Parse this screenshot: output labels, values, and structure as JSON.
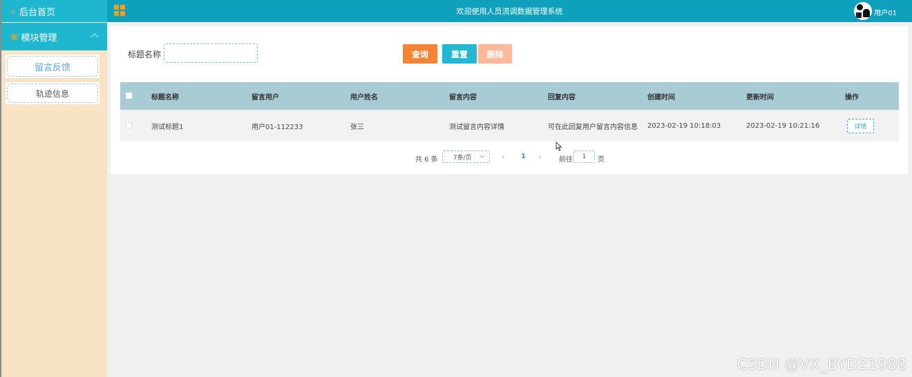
{
  "sidebar": {
    "home_label": "后台首页",
    "module_label": "模块管理",
    "items": [
      {
        "label": "留言反馈"
      },
      {
        "label": "轨迹信息"
      }
    ]
  },
  "header": {
    "title": "欢迎使用人员流调数据管理系统",
    "user_name": "用户01"
  },
  "search": {
    "label": "标题名称",
    "value": "",
    "placeholder": ""
  },
  "actions": {
    "query_label": "查询",
    "reset_label": "重置",
    "delete_label": "删除"
  },
  "table": {
    "columns": [
      "标题名称",
      "留言用户",
      "用户姓名",
      "留言内容",
      "回复内容",
      "创建时间",
      "更新时间",
      "操作"
    ],
    "rows": [
      {
        "title": "测试标题1",
        "user": "用户01-112233",
        "name": "张三",
        "content": "测试留言内容详情",
        "reply": "可在此回复用户留言内容信息",
        "created": "2023-02-19 10:18:03",
        "updated": "2023-02-19 10:21:16",
        "action_label": "详情"
      }
    ]
  },
  "pagination": {
    "total_text": "共 6 条",
    "page_size": "7条/页",
    "current_page": "1",
    "goto_label": "前往",
    "goto_value": "1",
    "page_suffix": "页"
  },
  "watermark": "CSDN @VX_BYDZ1988",
  "colors": {
    "header": "#0fa0bd",
    "sidebar_bg": "#f8e3c4",
    "query": "#f48336",
    "reset": "#23b7d3",
    "delete": "#f9b99a",
    "table_head": "#a8cbd4"
  }
}
